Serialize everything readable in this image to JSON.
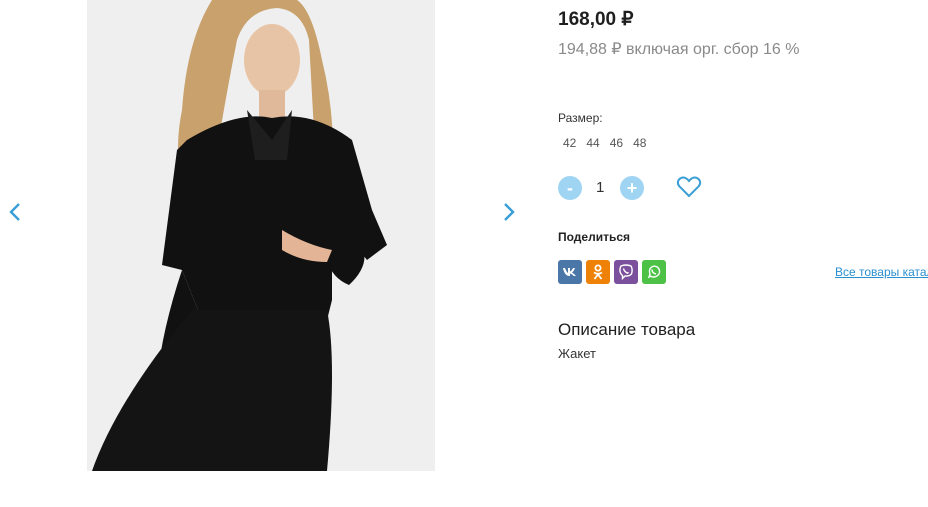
{
  "product": {
    "price": "168,00 ₽",
    "price_with_fee": "194,88 ₽ включая орг. сбор 16 %",
    "size_label": "Размер:",
    "sizes": [
      "42",
      "44",
      "46",
      "48"
    ],
    "quantity": "1",
    "minus_label": "-",
    "plus_label": "+"
  },
  "share": {
    "label": "Поделиться",
    "networks": [
      "vk-icon",
      "odnoklassniki-icon",
      "viber-icon",
      "whatsapp-icon"
    ],
    "colors": {
      "vk": "#4a76a8",
      "ok": "#ee8208",
      "viber": "#7b519d",
      "whatsapp": "#4dc247"
    }
  },
  "links": {
    "all_items": "Все товары каталога"
  },
  "description": {
    "title": "Описание товара",
    "text": "Жакет"
  },
  "colors": {
    "accent": "#2a8fd0",
    "qty_button": "#9fd4f3",
    "arrow": "#3a9fd6"
  }
}
